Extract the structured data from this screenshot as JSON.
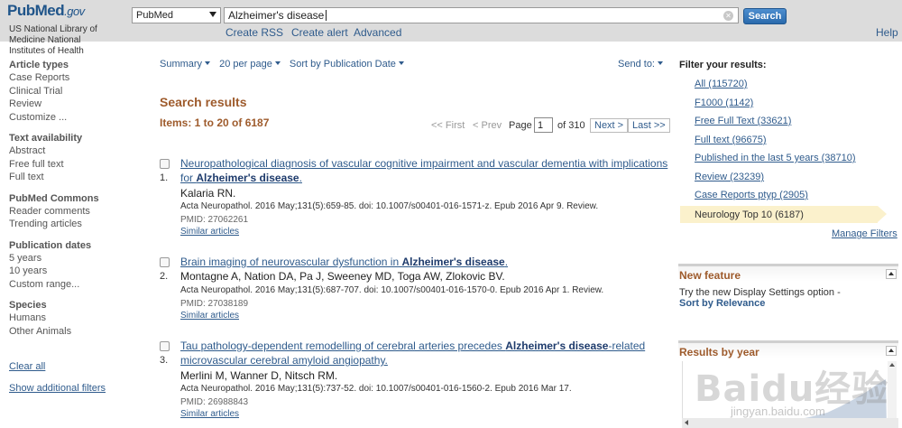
{
  "header": {
    "logo_main": "PubMed",
    "logo_suffix": ".gov",
    "nlm_text": "US National Library of Medicine National Institutes of Health",
    "database_select": "PubMed",
    "search_value": "Alzheimer's disease",
    "search_button": "Search",
    "links": [
      "Create RSS",
      "Create alert",
      "Advanced"
    ],
    "help": "Help"
  },
  "sidebar": {
    "groups": [
      {
        "heading": "Article types",
        "items": [
          "Case Reports",
          "Clinical Trial",
          "Review",
          "Customize ..."
        ]
      },
      {
        "heading": "Text availability",
        "items": [
          "Abstract",
          "Free full text",
          "Full text"
        ]
      },
      {
        "heading": "PubMed Commons",
        "items": [
          "Reader comments",
          "Trending articles"
        ]
      },
      {
        "heading": "Publication dates",
        "items": [
          "5 years",
          "10 years",
          "Custom range..."
        ]
      },
      {
        "heading": "Species",
        "items": [
          "Humans",
          "Other Animals"
        ]
      }
    ],
    "clear_all": "Clear all",
    "show_filters": "Show additional filters"
  },
  "display": {
    "summary": "Summary",
    "per_page": "20 per page",
    "sort": "Sort by Publication Date",
    "send_to": "Send to:"
  },
  "results": {
    "title": "Search results",
    "items": "Items: 1 to 20 of 6187",
    "pager": {
      "first": "<< First",
      "prev": "< Prev",
      "page_label": "Page",
      "page_value": "1",
      "of_total": "of 310",
      "next": "Next >",
      "last": "Last >>"
    },
    "list": [
      {
        "num": "1.",
        "title_a": "Neuropathological diagnosis of vascular cognitive impairment and vascular dementia with implications for ",
        "title_b": "Alzheimer's disease",
        "title_c": ".",
        "authors": "Kalaria RN.",
        "journal": "Acta Neuropathol. 2016 May;131(5):659-85. doi: 10.1007/s00401-016-1571-z. Epub 2016 Apr 9. Review.",
        "pmid": "PMID: 27062261",
        "similar": "Similar articles"
      },
      {
        "num": "2.",
        "title_a": "Brain imaging of neurovascular dysfunction in ",
        "title_b": "Alzheimer's disease",
        "title_c": ".",
        "authors": "Montagne A, Nation DA, Pa J, Sweeney MD, Toga AW, Zlokovic BV.",
        "journal": "Acta Neuropathol. 2016 May;131(5):687-707. doi: 10.1007/s00401-016-1570-0. Epub 2016 Apr 1. Review.",
        "pmid": "PMID: 27038189",
        "similar": "Similar articles"
      },
      {
        "num": "3.",
        "title_a": "Tau pathology-dependent remodelling of cerebral arteries precedes ",
        "title_b": "Alzheimer's disease",
        "title_c": "-related microvascular cerebral amyloid angiopathy.",
        "authors": "Merlini M, Wanner D, Nitsch RM.",
        "journal": "Acta Neuropathol. 2016 May;131(5):737-52. doi: 10.1007/s00401-016-1560-2. Epub 2016 Mar 17.",
        "pmid": "PMID: 26988843",
        "similar": "Similar articles"
      }
    ]
  },
  "right": {
    "filter_heading": "Filter your results:",
    "filters": [
      "All (115720)",
      "F1000 (1142)",
      "Free Full Text (33621)",
      "Full text (96675)",
      "Published in the last 5 years (38710)",
      "Review (23239)",
      "Case Reports ptyp (2905)"
    ],
    "active_filter": "Neurology Top 10 (6187)",
    "manage_filters": "Manage Filters",
    "new_feature_title": "New feature",
    "new_feature_text": "Try the new Display Settings option -",
    "new_feature_link": "Sort by Relevance",
    "results_by_year": "Results by year"
  },
  "watermark": {
    "text": "Baidu经验",
    "url": "jingyan.baidu.com"
  },
  "colors": {
    "header_bg": "#dcdcdc",
    "link": "#2f5b8c",
    "heading": "#9e5b2c",
    "active_filter_bg": "#fbf1cc"
  }
}
